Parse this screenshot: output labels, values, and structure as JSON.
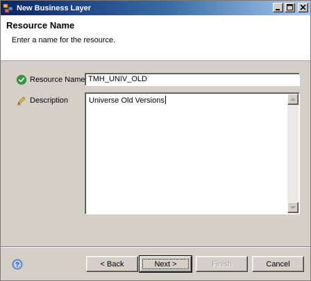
{
  "window": {
    "title": "New Business Layer",
    "title_bar_color": "#0a246a",
    "icons": {
      "app": "business-layer-icon",
      "minimize": "minimize-icon",
      "maximize": "maximize-icon",
      "close": "close-icon"
    }
  },
  "banner": {
    "title": "Resource Name",
    "subtitle": "Enter a name for the resource."
  },
  "form": {
    "resource_name": {
      "label": "Resource Name",
      "value": "TMH_UNIV_OLD",
      "status_icon": "check-ok-icon",
      "status_color": "#2e9e3e"
    },
    "description": {
      "label": "Description",
      "value": "Universe Old Versions",
      "icon": "pencil-icon"
    }
  },
  "footer": {
    "help_icon": "help-icon",
    "buttons": {
      "back": "< Back",
      "next": "Next >",
      "finish": "Finish",
      "cancel": "Cancel"
    }
  }
}
